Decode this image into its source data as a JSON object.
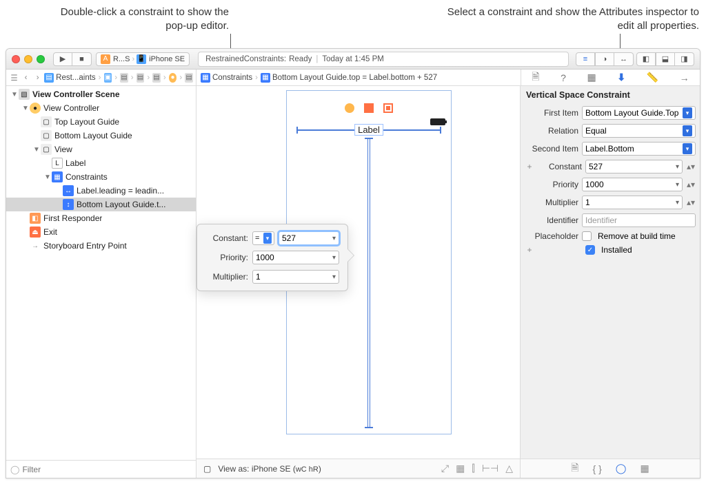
{
  "callouts": {
    "left": "Double-click a constraint to show the pop-up editor.",
    "right": "Select a constraint and show the Attributes inspector to edit all properties."
  },
  "toolbar": {
    "scheme_project": "R...S",
    "scheme_device": "iPhone SE",
    "status_project": "RestrainedConstraints:",
    "status_state": "Ready",
    "status_time": "Today at 1:45 PM"
  },
  "navigator_path": {
    "project": "Rest...aints"
  },
  "jumpbar": {
    "group": "Constraints",
    "item": "Bottom Layout Guide.top = Label.bottom + 527"
  },
  "outline": {
    "scene": "View Controller Scene",
    "vc": "View Controller",
    "top_guide": "Top Layout Guide",
    "bottom_guide": "Bottom Layout Guide",
    "view": "View",
    "label": "Label",
    "constraints": "Constraints",
    "c1": "Label.leading = leadin...",
    "c2": "Bottom Layout Guide.t...",
    "first_responder": "First Responder",
    "exit": "Exit",
    "entry_point": "Storyboard Entry Point"
  },
  "filter_placeholder": "Filter",
  "canvas": {
    "label_text": "Label",
    "view_as": "View as: iPhone SE (",
    "traits": "wC hR",
    "view_as_close": ")"
  },
  "popup": {
    "constant_label": "Constant:",
    "eq": "=",
    "constant_value": "527",
    "priority_label": "Priority:",
    "priority_value": "1000",
    "multiplier_label": "Multiplier:",
    "multiplier_value": "1"
  },
  "inspector": {
    "title": "Vertical Space Constraint",
    "first_item_label": "First Item",
    "first_item_value": "Bottom Layout Guide.Top",
    "relation_label": "Relation",
    "relation_value": "Equal",
    "second_item_label": "Second Item",
    "second_item_value": "Label.Bottom",
    "constant_label": "Constant",
    "constant_value": "527",
    "priority_label": "Priority",
    "priority_value": "1000",
    "multiplier_label": "Multiplier",
    "multiplier_value": "1",
    "identifier_label": "Identifier",
    "identifier_placeholder": "Identifier",
    "placeholder_label": "Placeholder",
    "placeholder_check": "Remove at build time",
    "installed": "Installed"
  }
}
